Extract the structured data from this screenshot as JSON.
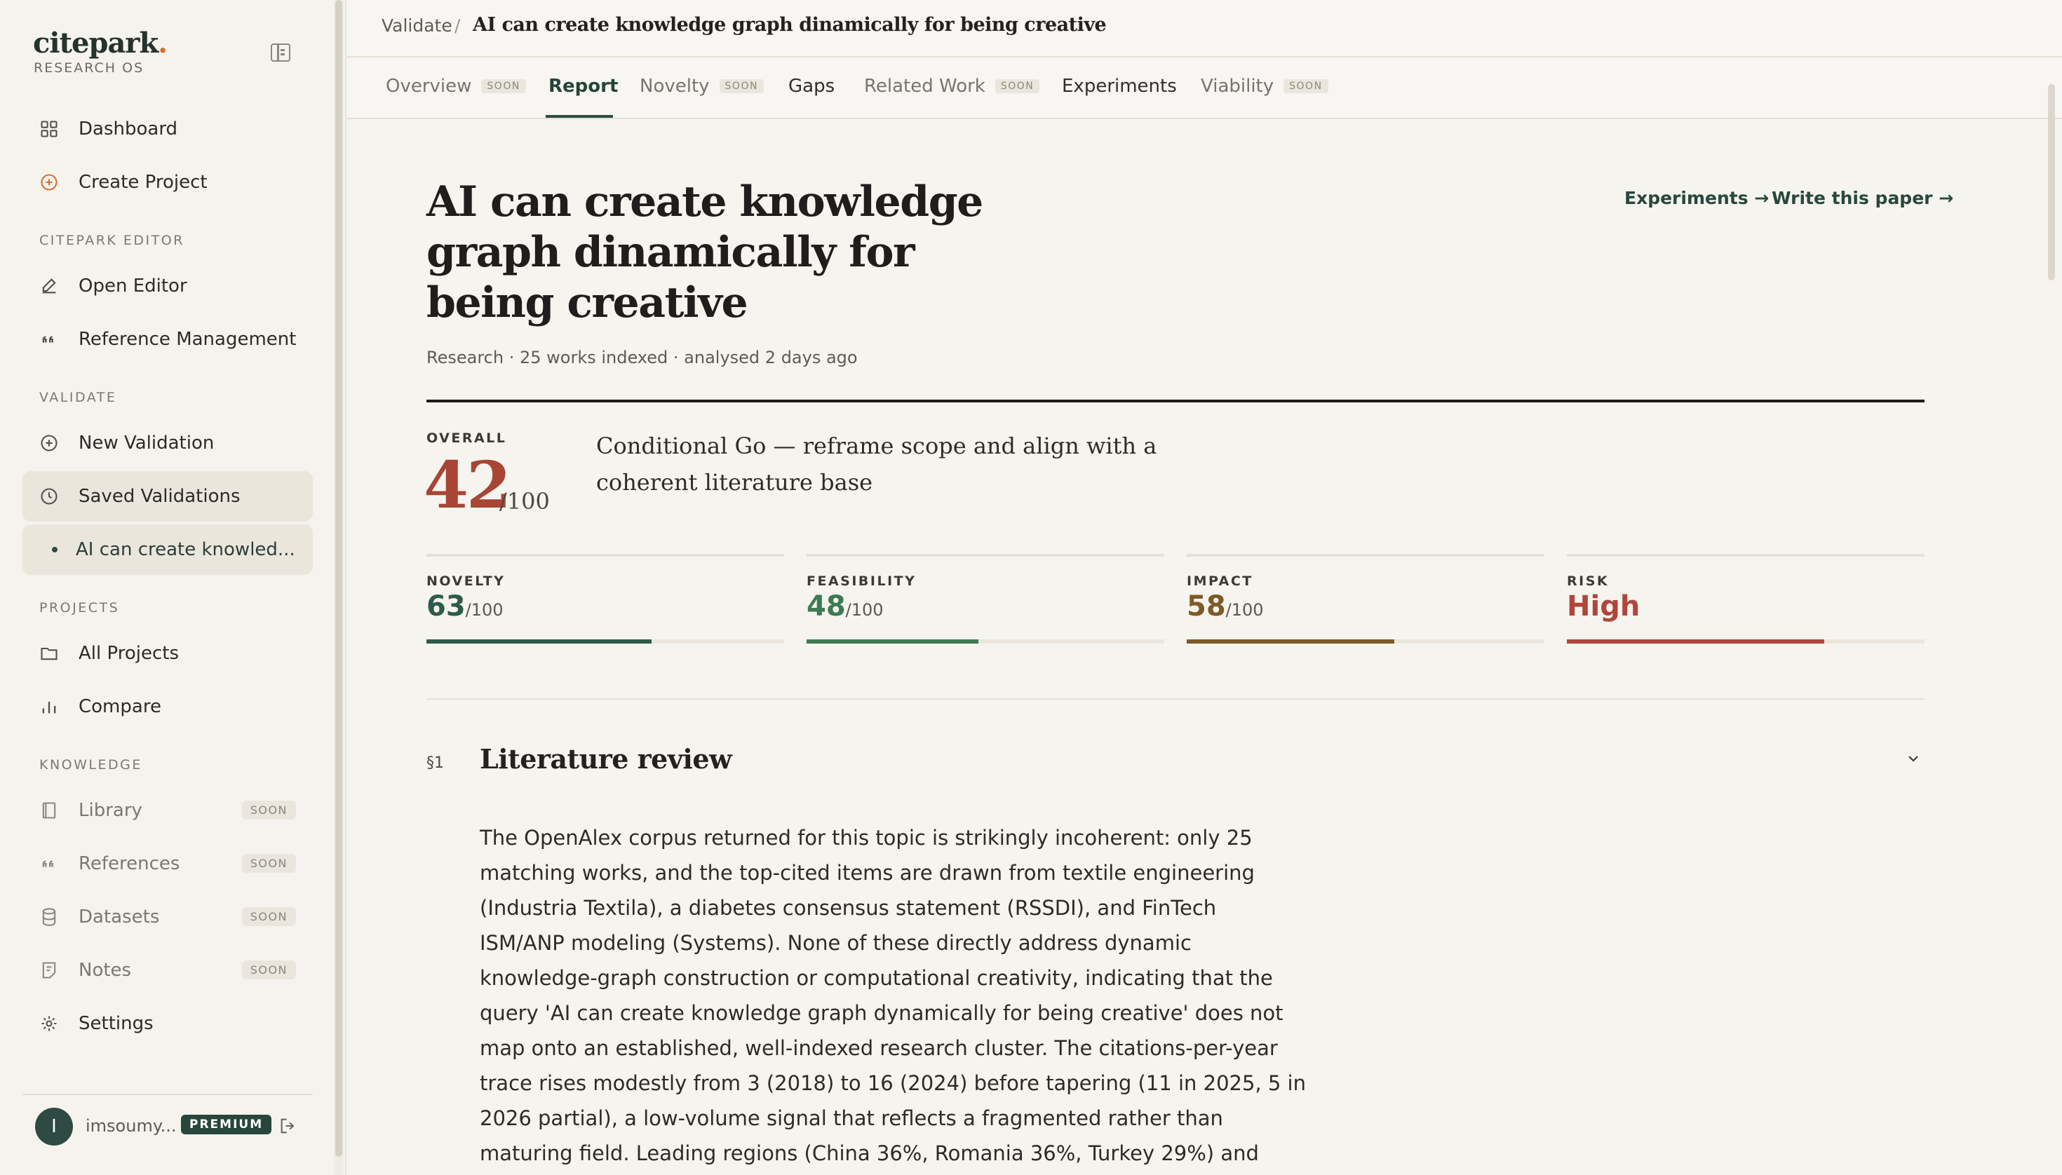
{
  "app": {
    "logo_text": "citepark",
    "logo_dot": ".",
    "logo_sub": "RESEARCH OS"
  },
  "sidebar": {
    "top_items": [
      {
        "label": "Dashboard",
        "icon": "grid-icon"
      },
      {
        "label": "Create Project",
        "icon": "plus-circle-icon"
      }
    ],
    "sections": {
      "editor": "CITEPARK EDITOR",
      "validate": "VALIDATE",
      "projects": "PROJECTS",
      "knowledge": "KNOWLEDGE"
    },
    "editor_items": [
      {
        "label": "Open Editor",
        "icon": "pen-icon"
      },
      {
        "label": "Reference Management",
        "icon": "quote-icon"
      }
    ],
    "validate_items": [
      {
        "label": "New Validation",
        "icon": "plus-circle-icon"
      },
      {
        "label": "Saved Validations",
        "icon": "clock-icon"
      },
      {
        "label": "AI can create knowled...",
        "icon": "dot-icon"
      }
    ],
    "project_items": [
      {
        "label": "All Projects",
        "icon": "folder-icon"
      },
      {
        "label": "Compare",
        "icon": "bar-chart-icon"
      }
    ],
    "knowledge_items": [
      {
        "label": "Library",
        "icon": "book-icon",
        "badge": "SOON"
      },
      {
        "label": "References",
        "icon": "quote-icon",
        "badge": "SOON"
      },
      {
        "label": "Datasets",
        "icon": "database-icon",
        "badge": "SOON"
      },
      {
        "label": "Notes",
        "icon": "note-icon",
        "badge": "SOON"
      }
    ],
    "settings": {
      "label": "Settings",
      "icon": "gear-icon"
    },
    "user": {
      "initial": "I",
      "name": "imsoumy...",
      "plan": "PREMIUM"
    }
  },
  "header": {
    "breadcrumb_root": "Validate",
    "breadcrumb_sep": "/",
    "breadcrumb_current": "AI can create knowledge graph dinamically for being creative"
  },
  "tabs": [
    {
      "label": "Overview",
      "badge": "SOON"
    },
    {
      "label": "Report",
      "badge": ""
    },
    {
      "label": "Novelty",
      "badge": "SOON"
    },
    {
      "label": "Gaps",
      "badge": ""
    },
    {
      "label": "Related Work",
      "badge": "SOON"
    },
    {
      "label": "Experiments",
      "badge": ""
    },
    {
      "label": "Viability",
      "badge": "SOON"
    }
  ],
  "report": {
    "title": "AI can create knowledge graph dinamically for being creative",
    "meta": "Research · 25 works indexed · analysed 2 days ago",
    "actions": {
      "experiments": "Experiments →",
      "write": "Write this paper →"
    },
    "overall": {
      "label": "OVERALL",
      "score": "42",
      "max": "/100",
      "verdict": "Conditional Go — reframe scope and align with a coherent literature base"
    },
    "metrics": [
      {
        "label": "NOVELTY",
        "value": "63",
        "max": "/100",
        "fill": 0.63,
        "color": "#2e5a4c"
      },
      {
        "label": "FEASIBILITY",
        "value": "48",
        "max": "/100",
        "fill": 0.48,
        "color": "#3e7a52"
      },
      {
        "label": "IMPACT",
        "value": "58",
        "max": "/100",
        "fill": 0.58,
        "color": "#7d5a26"
      },
      {
        "label": "RISK",
        "value": "High",
        "max": "",
        "fill": 0.72,
        "color": "#b0463b"
      }
    ],
    "section": {
      "number": "§1",
      "title": "Literature review",
      "body": "The OpenAlex corpus returned for this topic is strikingly incoherent: only 25 matching works, and the top-cited items are drawn from textile engineering (Industria Textila), a diabetes consensus statement (RSSDI), and FinTech ISM/ANP modeling (Systems). None of these directly address dynamic knowledge-graph construction or computational creativity, indicating that the query 'AI can create knowledge graph dynamically for being creative' does not map onto an established, well-indexed research cluster. The citations-per-year trace rises modestly from 3 (2018) to 16 (2024) before tapering (11 in 2025, 5 in 2026 partial), a low-volume signal that reflects a fragmented rather than maturing field. Leading regions (China 36%, Romania 36%, Turkey 29%) and most-cited authors (Demboski, Gupta, Makki,"
    }
  }
}
